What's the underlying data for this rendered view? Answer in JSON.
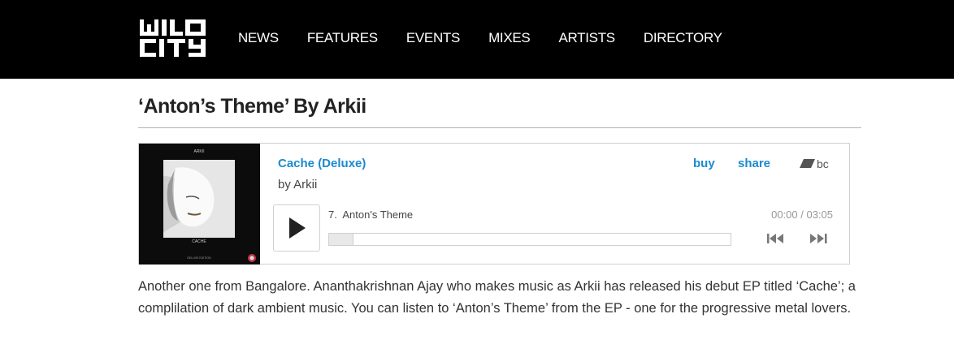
{
  "site": {
    "logo_text": "WILD CITY",
    "nav": [
      "NEWS",
      "FEATURES",
      "EVENTS",
      "MIXES",
      "ARTISTS",
      "DIRECTORY"
    ]
  },
  "article": {
    "title": "‘Anton’s Theme’ By Arkii",
    "body": "Another one from Bangalore. Ananthakrishnan Ajay who makes music as Arkii has released his debut EP titled ‘Cache’; a complilation of dark ambient music. You can listen to ‘Anton’s Theme’ from the EP - one for the progressive metal lovers."
  },
  "player": {
    "album": "Cache (Deluxe)",
    "artist": "by Arkii",
    "buy": "buy",
    "share": "share",
    "brand": "bc",
    "track_number": "7.",
    "track_title": "Anton's Theme",
    "time": "00:00 / 03:05",
    "progress": 0,
    "cover_text": {
      "top": "ARKII",
      "middle": "CACHE",
      "bottom": "DELUXE EDITION"
    },
    "accent_color": "#1a8ad0"
  }
}
